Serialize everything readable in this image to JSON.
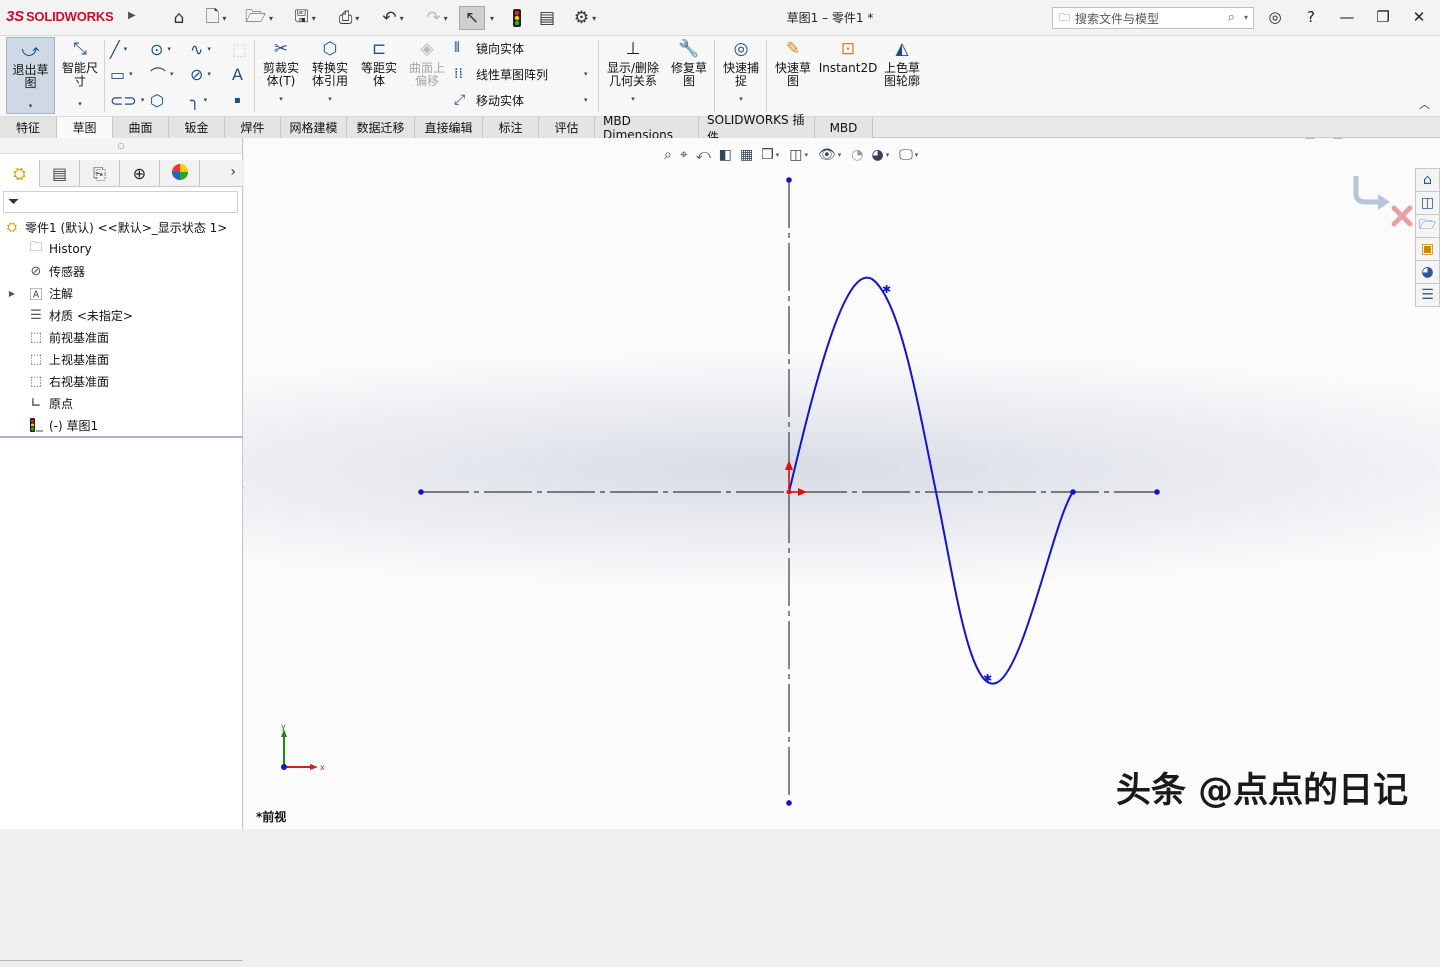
{
  "titlebar": {
    "logo_ds": "3S",
    "logo_text": "SOLIDWORKS",
    "document_title": "草图1 – 零件1 *",
    "search_placeholder": "搜索文件与模型"
  },
  "ribbon": {
    "exit_sketch": "退出草图",
    "smart_dimension": "智能尺寸",
    "trim_entities": "剪裁实体(T)",
    "convert_entities": "转换实体引用",
    "offset_entities": "等距实体",
    "offset_on_surface": "曲面上偏移",
    "mirror_entities": "镜向实体",
    "linear_pattern": "线性草图阵列",
    "move_entities": "移动实体",
    "display_relations": "显示/删除几何关系",
    "repair_sketch": "修复草图",
    "quick_snaps": "快速捕捉",
    "rapid_sketch": "快速草图",
    "instant2d": "Instant2D",
    "shaded_contours": "上色草图轮廓"
  },
  "tabs": [
    "特征",
    "草图",
    "曲面",
    "钣金",
    "焊件",
    "网格建模",
    "数据迁移",
    "直接编辑",
    "标注",
    "评估",
    "MBD Dimensions",
    "SOLIDWORKS 插件",
    "MBD"
  ],
  "active_tab": "草图",
  "tree": {
    "root": "零件1 (默认) <<默认>_显示状态 1>",
    "items": [
      "History",
      "传感器",
      "注解",
      "材质 <未指定>",
      "前视基准面",
      "上视基准面",
      "右视基准面",
      "原点",
      "(-) 草图1"
    ]
  },
  "viewport": {
    "view_name": "*前视",
    "triad_x": "x",
    "triad_y": "y",
    "watermark": "头条 @点点的日记"
  },
  "colors": {
    "curve": "#1414c8",
    "centerline": "#3a3a3a",
    "endpoint": "#1414c8",
    "origin": "#e01010",
    "brand": "#c8102e"
  }
}
